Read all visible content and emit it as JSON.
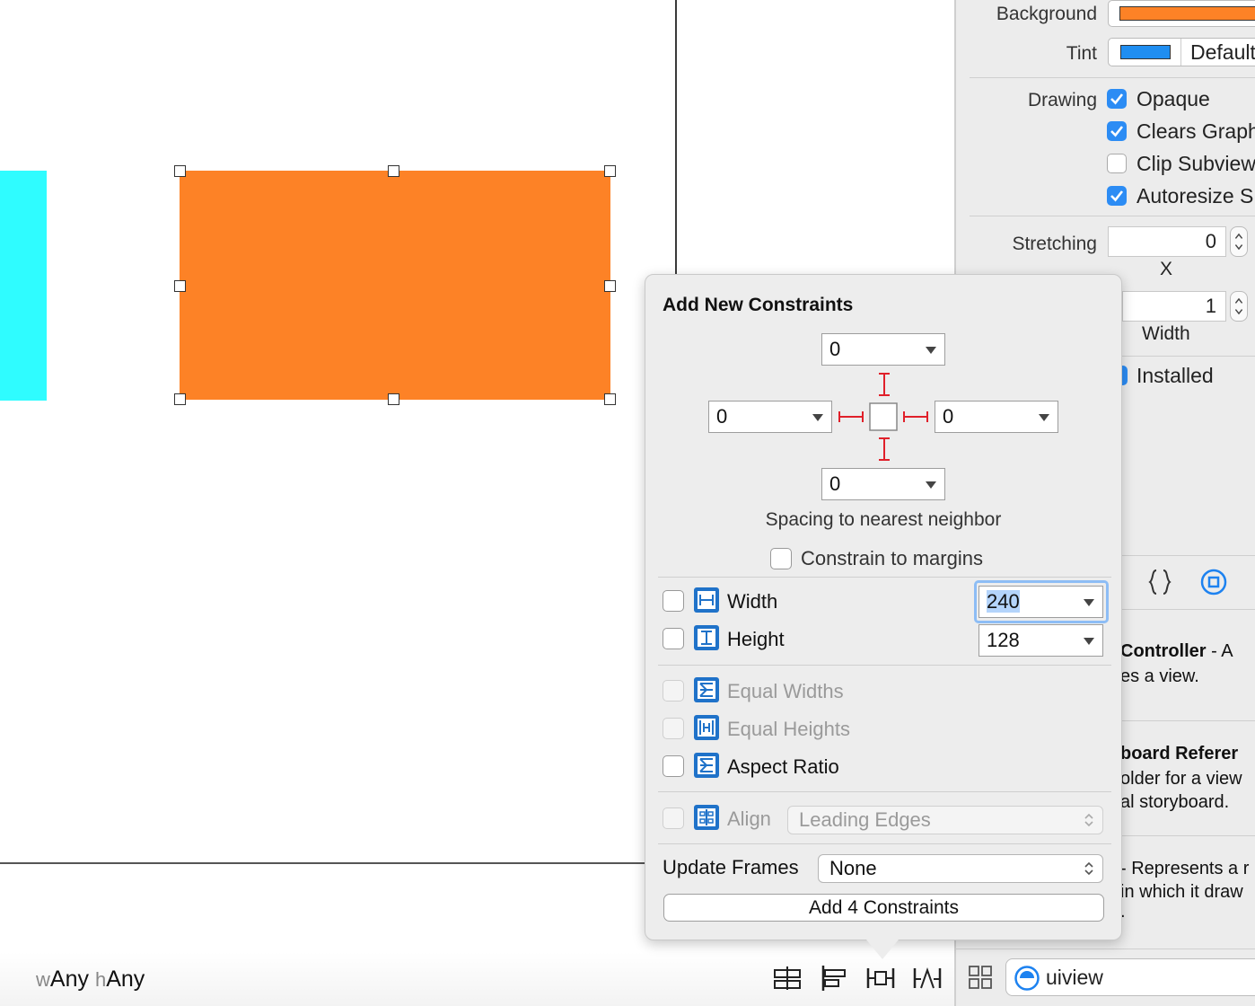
{
  "canvas": {
    "size_class": {
      "w_prefix": "w",
      "w_value": "Any",
      "h_prefix": "h",
      "h_value": "Any"
    }
  },
  "inspector": {
    "background_label": "Background",
    "background_color": "#fd8226",
    "tint_label": "Tint",
    "tint_color": "#1f8ef1",
    "tint_value": "Default",
    "drawing_label": "Drawing",
    "drawing_options": [
      {
        "label": "Opaque",
        "checked": true
      },
      {
        "label": "Clears Graph",
        "checked": true
      },
      {
        "label": "Clip Subview",
        "checked": false
      },
      {
        "label": "Autoresize S",
        "checked": true
      }
    ],
    "stretching_label": "Stretching",
    "stretch_x_value": "0",
    "stretch_x_caption": "X",
    "stretch_width_value": "1",
    "stretch_width_caption": "Width",
    "installed_label": "Installed",
    "library_items": [
      {
        "title": "Controller",
        "suffix": " - A",
        "desc": "es a view."
      },
      {
        "title": "board Referer",
        "desc_lines": [
          "older for a view",
          "al storyboard."
        ]
      },
      {
        "desc_lines": [
          "- Represents a r",
          "in which it draw",
          "."
        ]
      }
    ],
    "filter_text": "uiview"
  },
  "popover": {
    "title": "Add New Constraints",
    "spacing": {
      "top": "0",
      "left": "0",
      "right": "0",
      "bottom": "0"
    },
    "spacing_caption": "Spacing to nearest neighbor",
    "constrain_margins_label": "Constrain to margins",
    "width_label": "Width",
    "width_value": "240",
    "height_label": "Height",
    "height_value": "128",
    "equal_widths_label": "Equal Widths",
    "equal_heights_label": "Equal Heights",
    "aspect_ratio_label": "Aspect Ratio",
    "align_label": "Align",
    "align_value": "Leading Edges",
    "update_frames_label": "Update Frames",
    "update_frames_value": "None",
    "add_button_label": "Add 4 Constraints"
  }
}
